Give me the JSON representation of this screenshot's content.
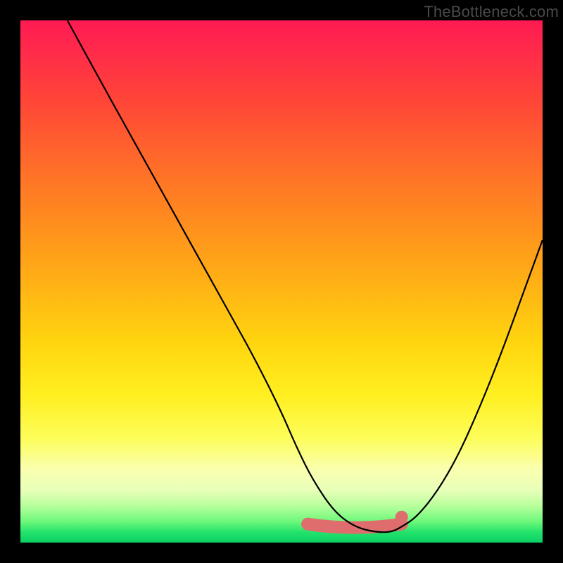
{
  "watermark": "TheBottleneck.com",
  "chart_data": {
    "type": "line",
    "title": "",
    "xlabel": "",
    "ylabel": "",
    "xlim": [
      0,
      100
    ],
    "ylim": [
      0,
      100
    ],
    "grid": false,
    "legend": false,
    "series": [
      {
        "name": "bottleneck-curve",
        "x": [
          9,
          15,
          20,
          25,
          30,
          35,
          40,
          45,
          50,
          53,
          56,
          60,
          64,
          68,
          71,
          73,
          76,
          80,
          84,
          88,
          92,
          96,
          100
        ],
        "y": [
          100,
          89,
          80,
          71,
          62,
          53,
          44,
          35,
          25,
          18,
          12,
          6,
          3,
          2,
          2,
          3,
          5,
          10,
          17,
          26,
          36,
          47,
          58
        ]
      }
    ],
    "highlight_band": {
      "name": "optimal-range",
      "color": "#e06d6d",
      "x": [
        55,
        73
      ],
      "y_approx": 3
    },
    "background_gradient": {
      "orientation": "vertical",
      "stops": [
        {
          "pos": 0,
          "color": "#ff1a52"
        },
        {
          "pos": 50,
          "color": "#ffb015"
        },
        {
          "pos": 80,
          "color": "#fdfd5a"
        },
        {
          "pos": 100,
          "color": "#0acf63"
        }
      ]
    }
  }
}
